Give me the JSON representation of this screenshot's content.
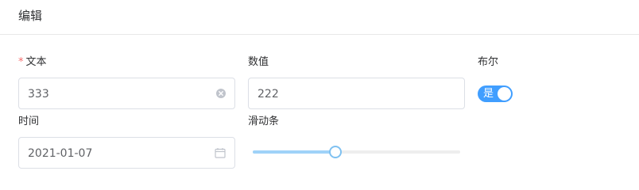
{
  "header": {
    "title": "编辑"
  },
  "fields": {
    "text": {
      "label": "文本",
      "required_mark": "*",
      "value": "333"
    },
    "number": {
      "label": "数值",
      "value": "222"
    },
    "bool": {
      "label": "布尔",
      "switch_text": "是",
      "on": true
    },
    "time": {
      "label": "时间",
      "value": "2021-01-07"
    },
    "slider": {
      "label": "滑动条",
      "value_fraction": 0.395
    }
  },
  "colors": {
    "accent": "#409eff",
    "required": "#f56c6c",
    "slider_fill": "#9fd2f8"
  },
  "icons": {
    "clear": "circle-close-icon",
    "date": "calendar-icon"
  }
}
